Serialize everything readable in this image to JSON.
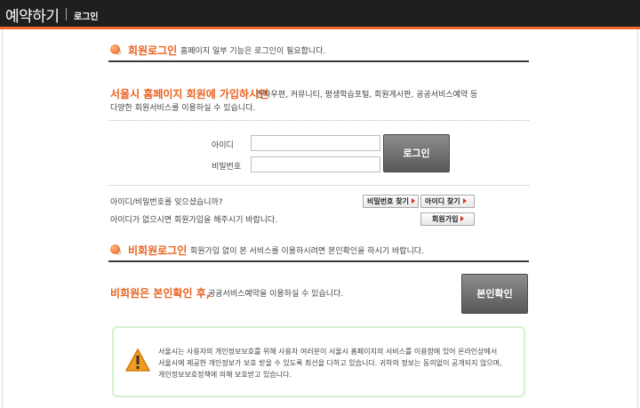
{
  "header": {
    "title": "예약하기",
    "subtitle": "로그인"
  },
  "member_login": {
    "heading": "회원로그인",
    "description": "홈페이지 일부 기능은 로그인이 필요합니다.",
    "intro_highlight": "서울시 홈페이지 회원에 가입하시면",
    "intro_rest": "전자우편, 커뮤니티, 평생학습포털, 회원게시판, 공공서비스예약 등",
    "intro_line2": "다양한 회원서비스를 이용하실 수 있습니다.",
    "id_label": "아이디",
    "password_label": "비밀번호",
    "id_value": "",
    "password_value": "",
    "login_button": "로그인",
    "forgot_text": "아이디/비밀번호를 잊으셨습니까?",
    "find_password_button": "비밀번호 찾기",
    "find_id_button": "아이디 찾기",
    "no_id_text": "아이디가 없으시면 회원가입을 해주시기 바랍니다.",
    "join_button": "회원가입"
  },
  "nonmember_login": {
    "heading": "비회원로그인",
    "description": "회원가입 없이 본 서비스를 이용하시려면 본인확인을 하시기 바랍니다.",
    "highlight": "비회원은 본인확인 후,",
    "rest": "공공서비스예약을 이용하실 수 있습니다.",
    "verify_button": "본인확인"
  },
  "notice": {
    "icon": "warning-icon",
    "line1": "서울시는 사용자의 개인정보보호를 위해 사용자 여러분이 서울시 홈페이지의 서비스를 이용함에 있어 온라인상에서",
    "line2": "서울시에 제공한 개인정보가 보호 받을 수 있도록 최선을 다하고 있습니다. 귀하의 정보는 동의없이 공개되지 않으며,",
    "line3": "개인정보보호정책에 의해 보호받고 있습니다."
  },
  "colors": {
    "accent": "#e8621f",
    "topbar": "#1f1f1f",
    "notice_border": "#d8efd0"
  }
}
